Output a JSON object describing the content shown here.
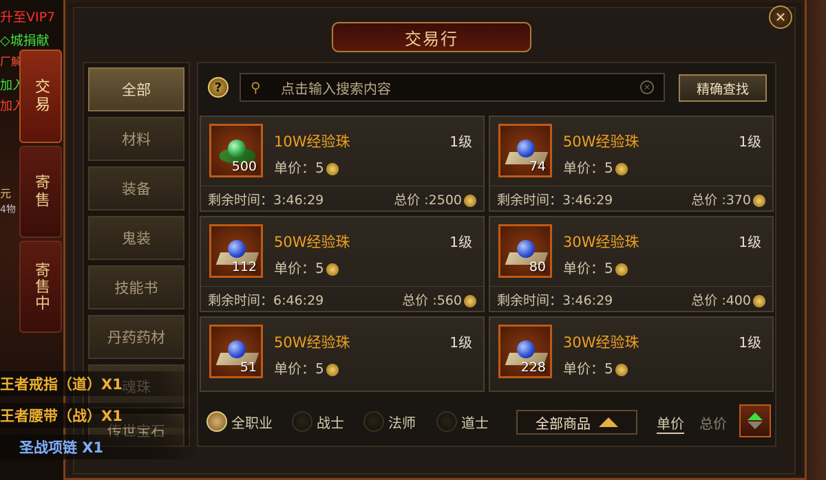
{
  "left_overlay": {
    "line1": "升至VIP7",
    "line2": "◇城捐献",
    "line3": "厂解",
    "line4": "加入",
    "line5": "加入",
    "line6": "元",
    "line7": "4物"
  },
  "side_tabs": [
    {
      "label": "交易"
    },
    {
      "label": "寄售"
    },
    {
      "label": "寄售中"
    }
  ],
  "window": {
    "title": "交易行",
    "close_label": "✕"
  },
  "categories": [
    {
      "label": "全部"
    },
    {
      "label": "材料"
    },
    {
      "label": "装备"
    },
    {
      "label": "鬼装"
    },
    {
      "label": "技能书"
    },
    {
      "label": "丹药药材"
    },
    {
      "label": "魂珠"
    },
    {
      "label": "传世宝石"
    }
  ],
  "search": {
    "help_label": "?",
    "placeholder": "点击输入搜索内容",
    "exact_button": "精确查找"
  },
  "items": [
    {
      "name": "10W经验珠",
      "level": "1级",
      "qty": "500",
      "price_label": "单价：5",
      "remain": "剩余时间：3:46:29",
      "total": "总价 :2500",
      "orb": "green-orb-icon"
    },
    {
      "name": "50W经验珠",
      "level": "1级",
      "qty": "74",
      "price_label": "单价：5",
      "remain": "剩余时间：3:46:29",
      "total": "总价 :370",
      "orb": "blue-orb-icon"
    },
    {
      "name": "50W经验珠",
      "level": "1级",
      "qty": "112",
      "price_label": "单价：5",
      "remain": "剩余时间：6:46:29",
      "total": "总价 :560",
      "orb": "blue-orb-icon"
    },
    {
      "name": "30W经验珠",
      "level": "1级",
      "qty": "80",
      "price_label": "单价：5",
      "remain": "剩余时间：3:46:29",
      "total": "总价 :400",
      "orb": "blue-orb-icon"
    },
    {
      "name": "50W经验珠",
      "level": "1级",
      "qty": "51",
      "price_label": "单价：5",
      "remain": "",
      "total": "",
      "orb": "blue-orb-icon"
    },
    {
      "name": "30W经验珠",
      "level": "1级",
      "qty": "228",
      "price_label": "单价：5",
      "remain": "",
      "total": "",
      "orb": "blue-orb-icon"
    }
  ],
  "filters": {
    "classes": [
      {
        "label": "全职业",
        "selected": true
      },
      {
        "label": "战士",
        "selected": false
      },
      {
        "label": "法师",
        "selected": false
      },
      {
        "label": "道士",
        "selected": false
      }
    ],
    "goods_dropdown": "全部商品",
    "sort_unit": "单价",
    "sort_total": "总价"
  },
  "notifications": [
    {
      "text": "王者戒指（道）X1",
      "color": "#f0b030"
    },
    {
      "text": "王者腰带（战）X1",
      "color": "#f0b030"
    },
    {
      "text": "圣战项链 X1",
      "color": "#80b0ff"
    }
  ],
  "colors": {
    "accent": "#f0a020",
    "frame": "#7a4020"
  }
}
